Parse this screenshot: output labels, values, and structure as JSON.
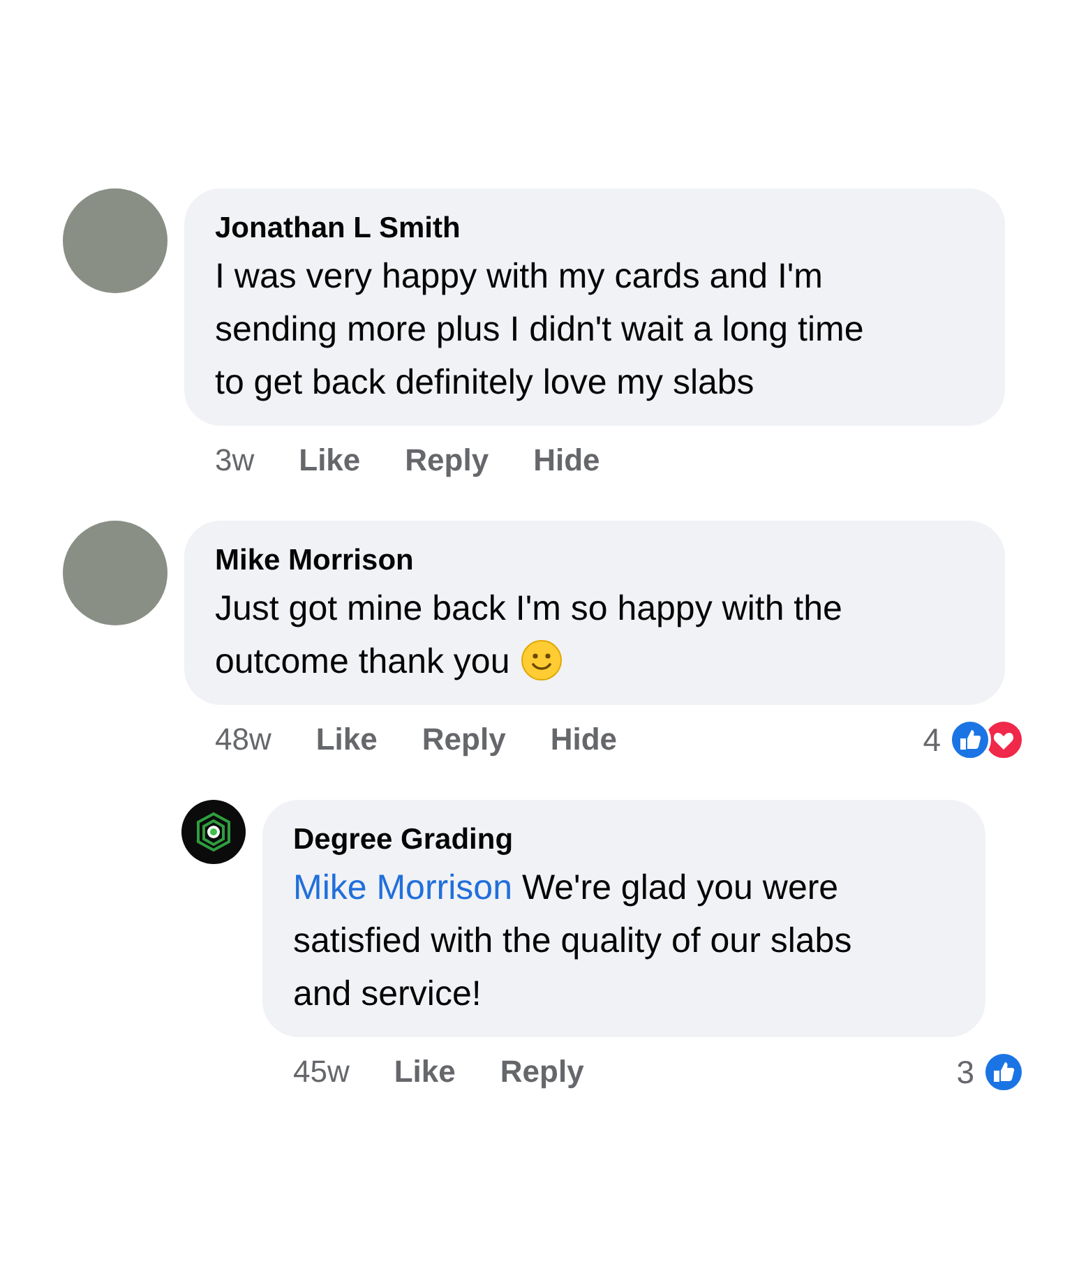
{
  "comments": [
    {
      "kind": "person",
      "author": "Jonathan L Smith",
      "text": "I was very happy with my cards and I'm sending more plus I didn't wait a long time to get back definitely love my slabs",
      "smiley": false,
      "time": "3w",
      "actions": [
        "Like",
        "Reply",
        "Hide"
      ]
    },
    {
      "kind": "person",
      "author": "Mike Morrison",
      "text": "Just got mine back I'm so happy with the outcome thank you",
      "smiley": true,
      "time": "48w",
      "actions": [
        "Like",
        "Reply",
        "Hide"
      ],
      "reactions": {
        "count": "4",
        "icons": [
          {
            "kind": "like"
          },
          {
            "kind": "love"
          }
        ]
      },
      "replies": [
        {
          "kind": "page",
          "author": "Degree Grading",
          "mention": "Mike Morrison",
          "text": "We're glad you were satisfied with the quality of our slabs and service!",
          "smiley": false,
          "time": "45w",
          "actions": [
            "Like",
            "Reply"
          ],
          "reactions": {
            "count": "3",
            "icons": [
              {
                "kind": "like"
              }
            ]
          }
        }
      ]
    }
  ]
}
